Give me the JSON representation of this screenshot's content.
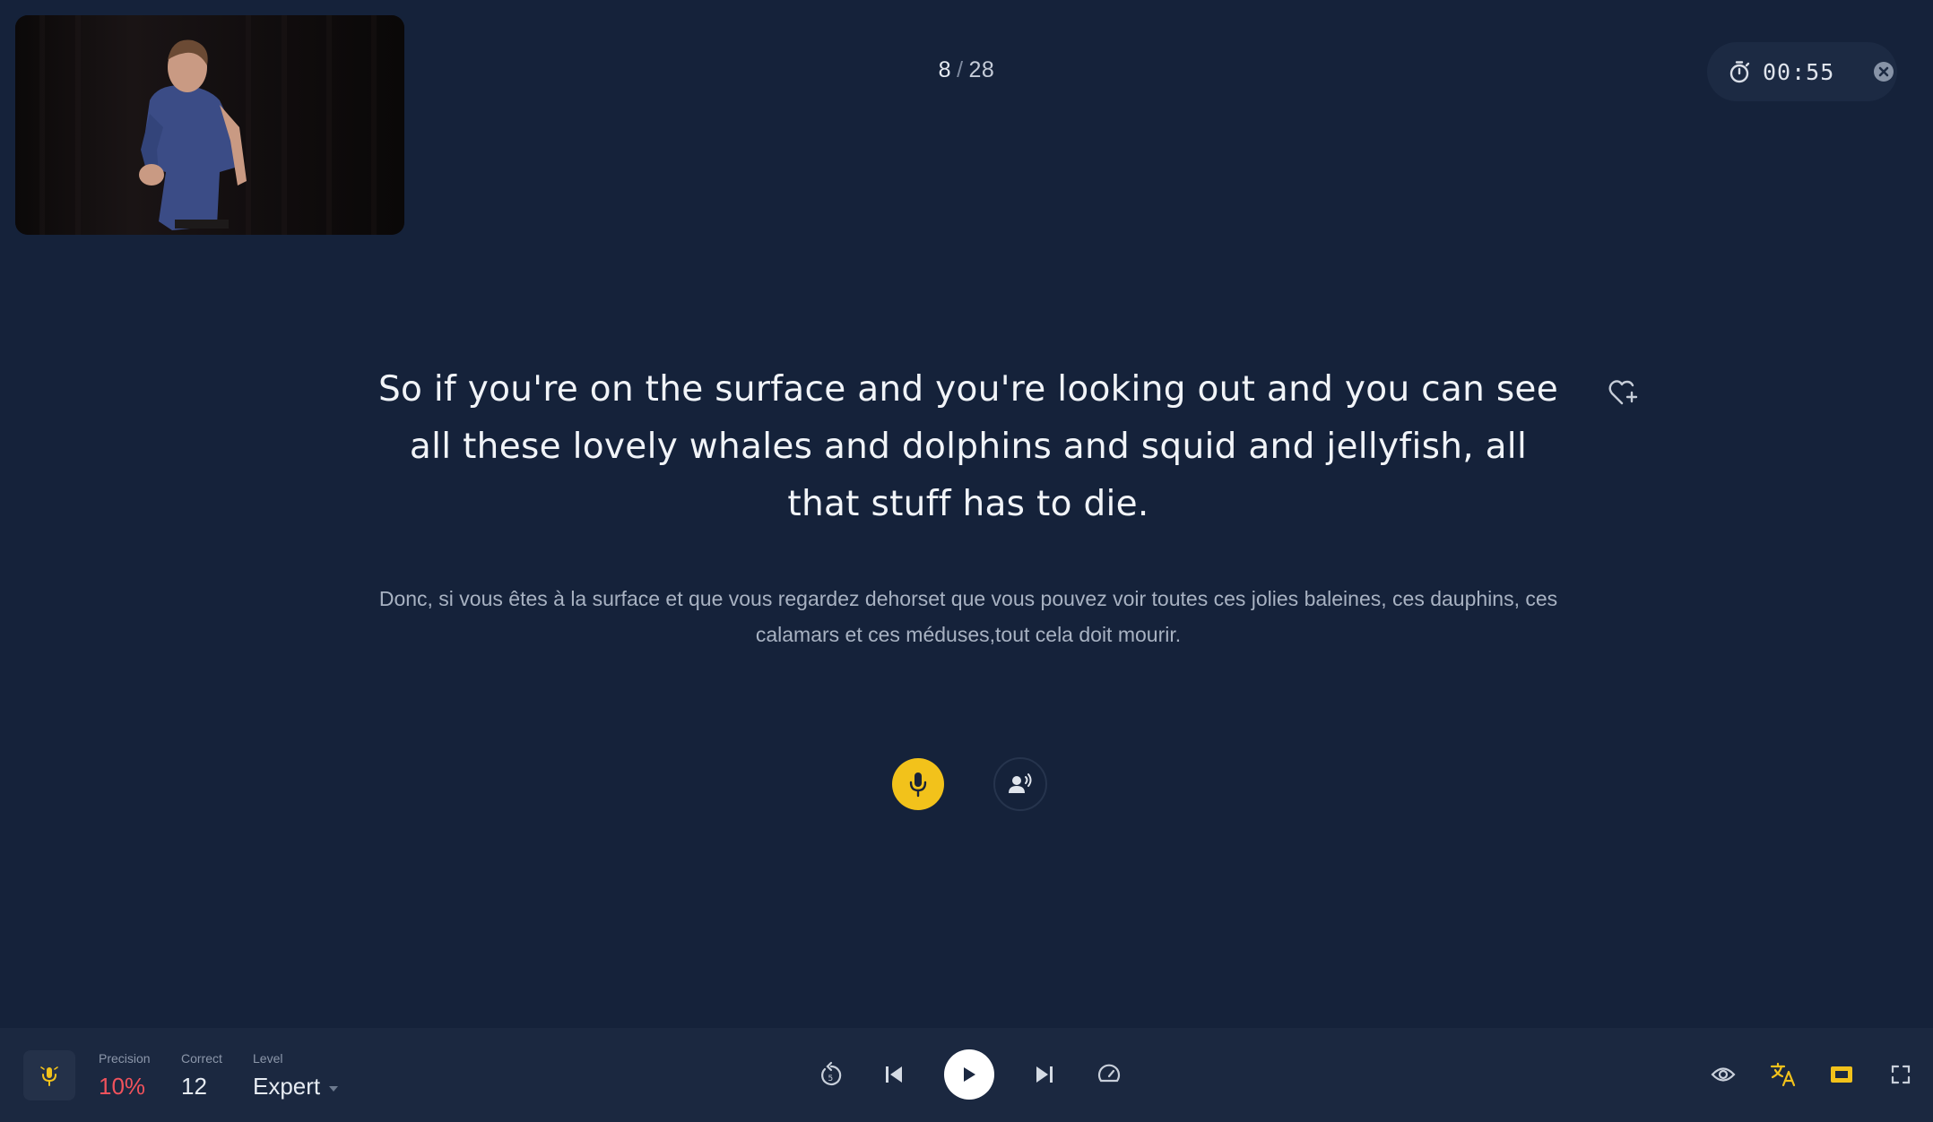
{
  "progress": {
    "current": "8",
    "separator": "/",
    "total": "28"
  },
  "timer": {
    "value": "00:55"
  },
  "sentence": {
    "english": "So if you're on the surface and you're looking out and you can see all these lovely whales and dolphins and squid and jellyfish, all that stuff has to die.",
    "translation": "Donc, si vous êtes à la surface et que vous regardez dehorset que vous pouvez voir toutes ces jolies baleines, ces dauphins, ces calamars et ces méduses,tout cela doit mourir."
  },
  "stats": {
    "precision_label": "Precision",
    "precision_value": "10%",
    "correct_label": "Correct",
    "correct_value": "12",
    "level_label": "Level",
    "level_value": "Expert"
  },
  "colors": {
    "background": "#15223a",
    "bottom_bar": "#1b2840",
    "accent_yellow": "#f2c21b",
    "precision_red": "#f0525c"
  },
  "icons": {
    "timer": "stopwatch-icon",
    "close": "close-circle-icon",
    "favorite": "heart-plus-icon",
    "mic": "microphone-icon",
    "listen": "speaker-person-icon",
    "replay": "replay-5-icon",
    "previous": "skip-previous-icon",
    "play": "play-icon",
    "next": "skip-next-icon",
    "speed": "speedometer-icon",
    "eye": "eye-icon",
    "translate": "translate-icon",
    "subtitles": "subtitles-icon",
    "fullscreen": "fullscreen-icon"
  }
}
